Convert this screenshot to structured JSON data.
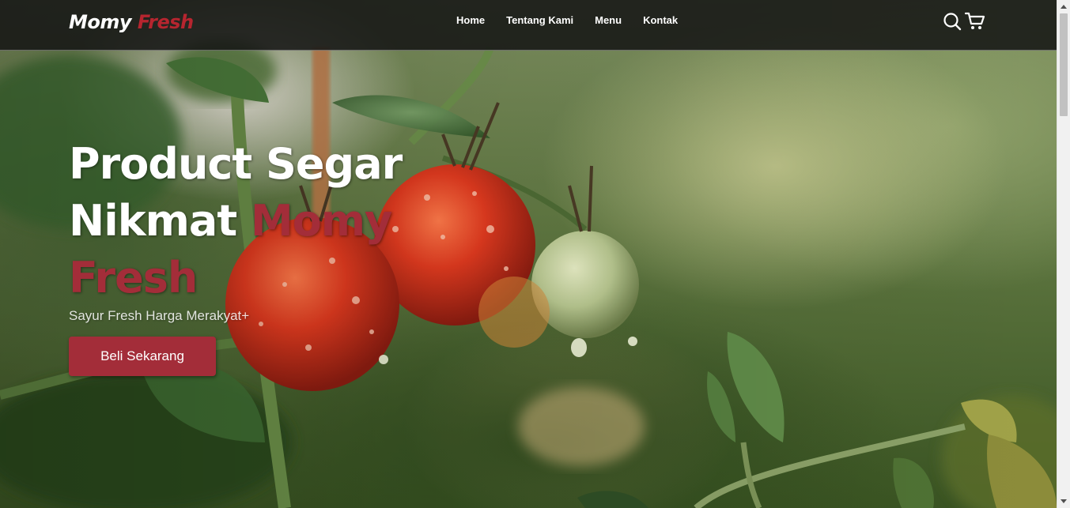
{
  "navbar": {
    "logo": {
      "main": "Momy",
      "accent": "Fresh"
    },
    "links": [
      "Home",
      "Tentang Kami",
      "Menu",
      "Kontak"
    ],
    "icons": [
      "search-icon",
      "shopping-cart-icon"
    ]
  },
  "hero": {
    "title_line1": "Product Segar",
    "title_line2_main": "Nikmat",
    "title_line2_accent": "Momy",
    "title_line3_accent": "Fresh",
    "subtitle": "Sayur Fresh Harga Merakyat+",
    "cta_label": "Beli Sekarang"
  },
  "colors": {
    "accent": "#a32d39",
    "navbar_bg": "#141414",
    "text": "#ffffff"
  }
}
